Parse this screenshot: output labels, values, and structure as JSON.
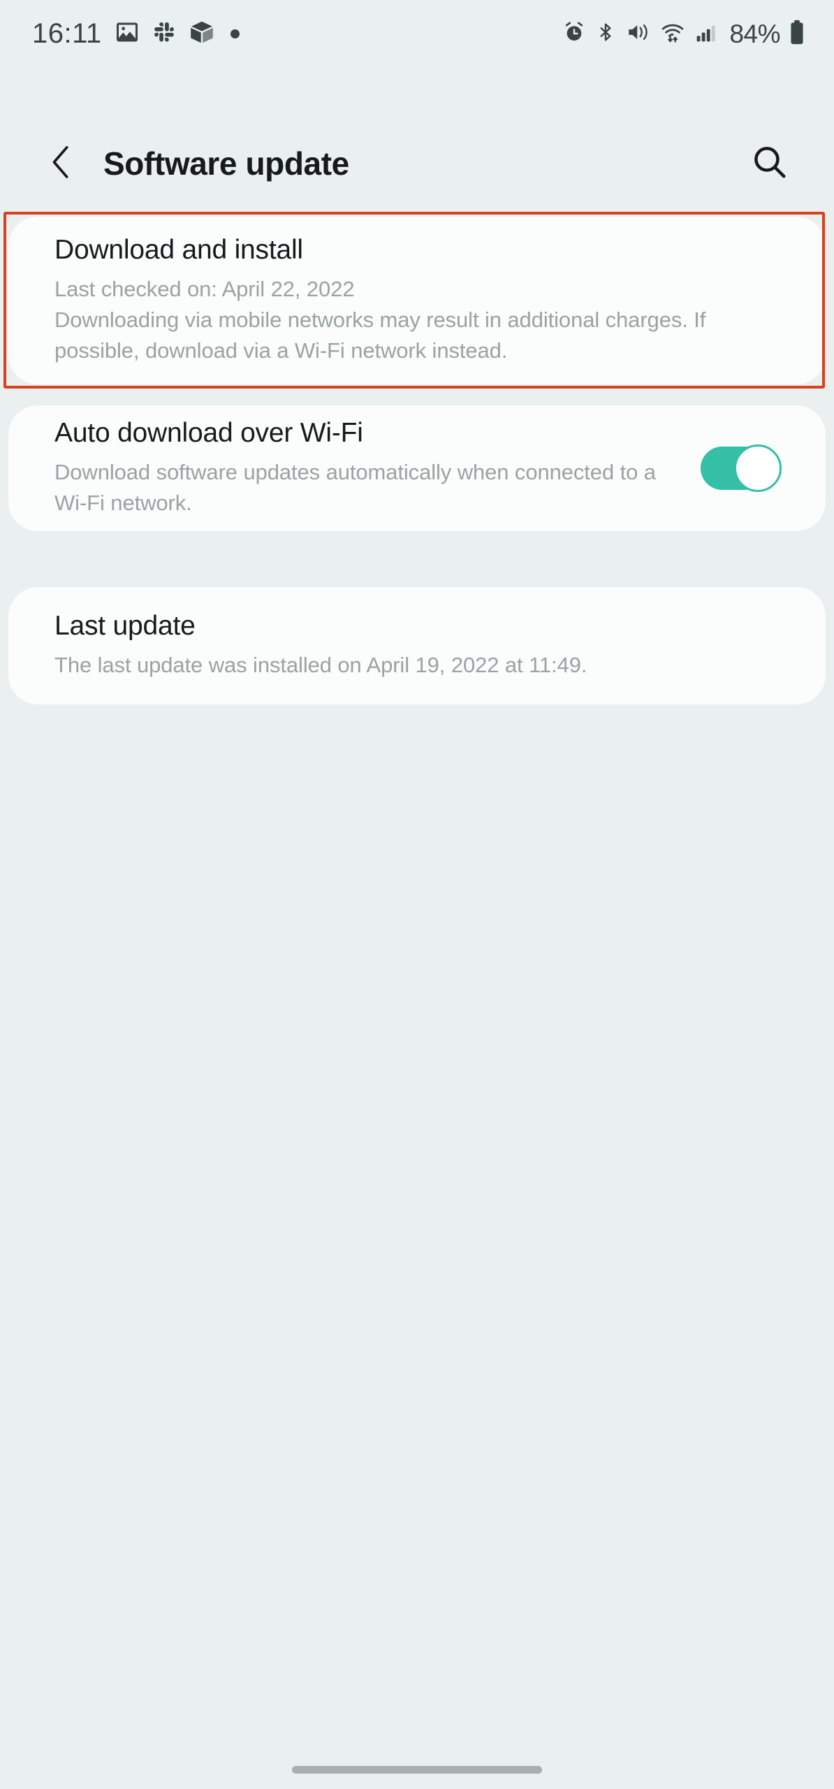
{
  "status_bar": {
    "time": "16:11",
    "battery_percent": "84%",
    "left_icons": [
      "gallery-icon",
      "slack-icon",
      "box-3d-icon",
      "dot-indicator-icon"
    ],
    "right_icons": [
      "alarm-icon",
      "bluetooth-icon",
      "mute-vibrate-icon",
      "wifi-icon",
      "signal-icon",
      "battery-icon"
    ]
  },
  "header": {
    "title": "Software update",
    "back_icon": "chevron-left-icon",
    "search_icon": "search-icon"
  },
  "cards": {
    "download": {
      "title": "Download and install",
      "last_checked": "Last checked on: April 22, 2022",
      "description": "Downloading via mobile networks may result in additional charges. If possible, download via a Wi-Fi network instead.",
      "highlight_color": "#d8401e"
    },
    "auto_download": {
      "title": "Auto download over Wi-Fi",
      "description": "Download software updates automatically when connected to a Wi-Fi network.",
      "toggle_state": "on",
      "toggle_color": "#35bfa7"
    },
    "last_update": {
      "title": "Last update",
      "description": "The last update was installed on April 19, 2022 at 11:49."
    }
  },
  "colors": {
    "background": "#e9f0ef",
    "card": "#fbfcfc",
    "title_text": "#17191a",
    "secondary_text": "#9aa3a2"
  }
}
